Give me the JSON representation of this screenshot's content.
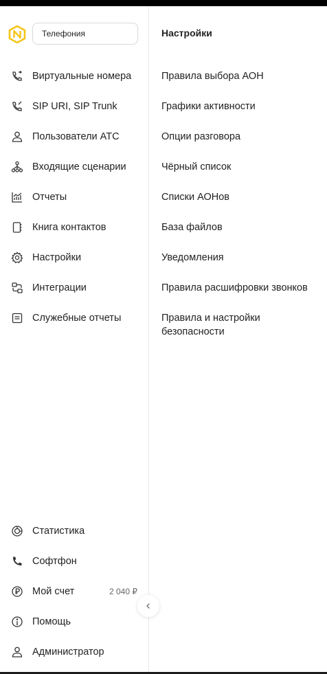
{
  "product_selector": {
    "value": "Телефония"
  },
  "sidebar": {
    "items": [
      {
        "label": "Виртуальные номера",
        "icon": "phone-forward-icon"
      },
      {
        "label": "SIP URI, SIP Trunk",
        "icon": "phone-sip-icon"
      },
      {
        "label": "Пользователи АТС",
        "icon": "user-icon"
      },
      {
        "label": "Входящие сценарии",
        "icon": "hierarchy-icon"
      },
      {
        "label": "Отчеты",
        "icon": "chart-icon"
      },
      {
        "label": "Книга контактов",
        "icon": "contact-book-icon"
      },
      {
        "label": "Настройки",
        "icon": "gear-icon"
      },
      {
        "label": "Интеграции",
        "icon": "integration-icon"
      },
      {
        "label": "Служебные отчеты",
        "icon": "document-icon"
      }
    ],
    "bottom_items": [
      {
        "label": "Статистика",
        "icon": "stats-icon"
      },
      {
        "label": "Софтфон",
        "icon": "phone-icon"
      },
      {
        "label": "Мой счет",
        "icon": "ruble-icon",
        "badge": "2 040 ₽"
      },
      {
        "label": "Помощь",
        "icon": "info-icon"
      },
      {
        "label": "Администратор",
        "icon": "user-icon"
      }
    ]
  },
  "settings_panel": {
    "title": "Настройки",
    "links": [
      "Правила выбора АОН",
      "Графики активности",
      "Опции разговора",
      "Чёрный список",
      "Списки АОНов",
      "База файлов",
      "Уведомления",
      "Правила расшифровки звонков",
      "Правила и настройки безопасности"
    ]
  },
  "colors": {
    "logo_accent": "#f5c518",
    "text": "#222222",
    "divider": "#e8e8e8"
  }
}
